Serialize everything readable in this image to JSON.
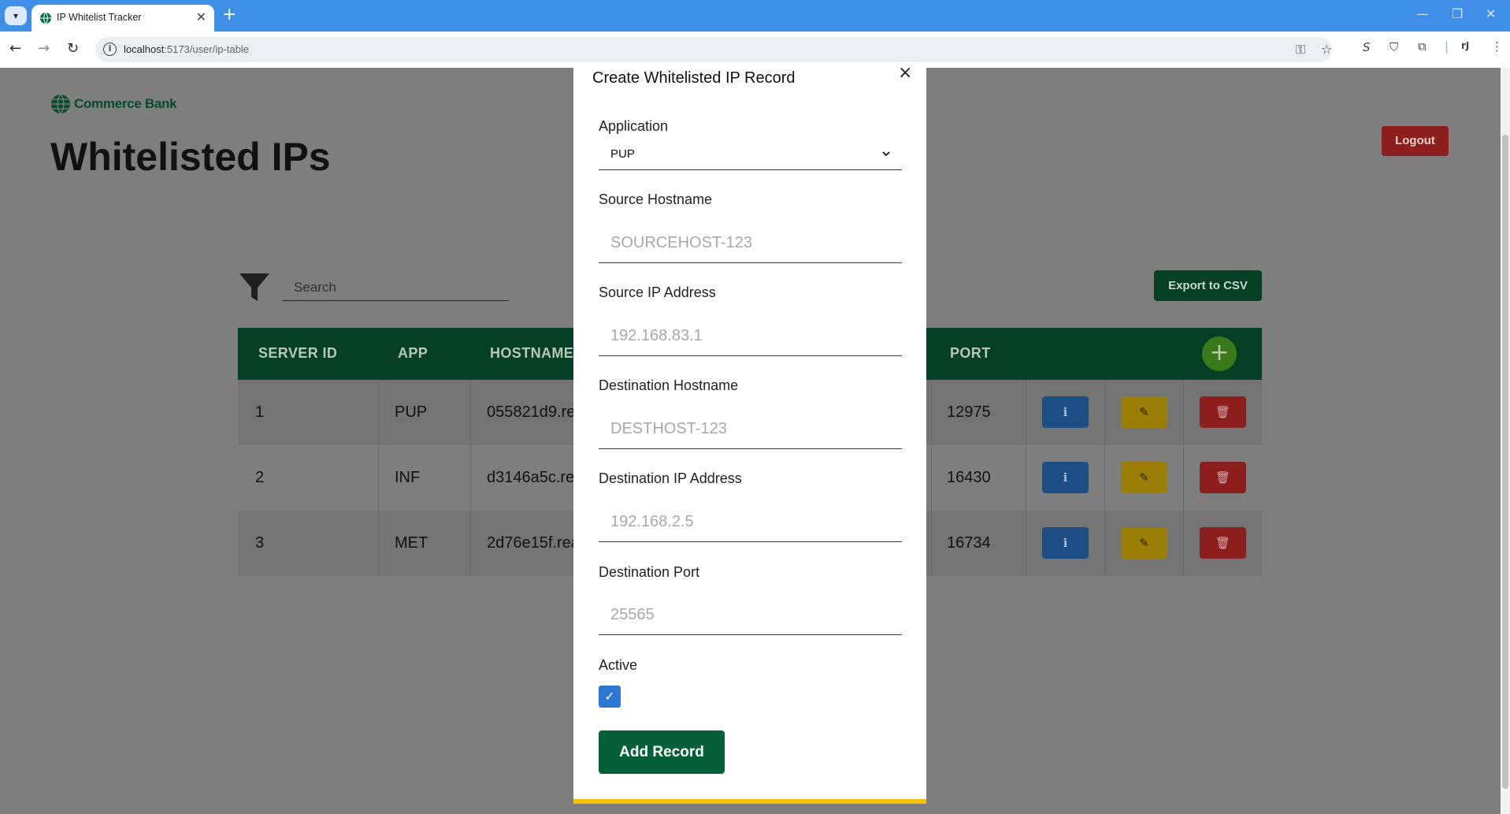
{
  "browser": {
    "tab_title": "IP Whitelist Tracker",
    "url_host": "localhost",
    "url_path": ":5173/user/ip-table"
  },
  "page": {
    "logo_text": "Commerce Bank",
    "title": "Whitelisted IPs",
    "logout_label": "Logout",
    "search_placeholder": "Search",
    "export_label": "Export to CSV"
  },
  "table": {
    "headers": [
      "SERVER ID",
      "APP",
      "HOSTNAME",
      "PORT"
    ],
    "rows": [
      {
        "id": "1",
        "app": "PUP",
        "hostname": "055821d9.re",
        "port": "12975"
      },
      {
        "id": "2",
        "app": "INF",
        "hostname": "d3146a5c.re",
        "port": "16430"
      },
      {
        "id": "3",
        "app": "MET",
        "hostname": "2d76e15f.rea",
        "port": "16734"
      }
    ]
  },
  "modal": {
    "title": "Create Whitelisted IP Record",
    "application_label": "Application",
    "application_value": "PUP",
    "source_hostname_label": "Source Hostname",
    "source_hostname_placeholder": "SOURCEHOST-123",
    "source_ip_label": "Source IP Address",
    "source_ip_placeholder": "192.168.83.1",
    "dest_hostname_label": "Destination Hostname",
    "dest_hostname_placeholder": "DESTHOST-123",
    "dest_ip_label": "Destination IP Address",
    "dest_ip_placeholder": "192.168.2.5",
    "dest_port_label": "Destination Port",
    "dest_port_placeholder": "25565",
    "active_label": "Active",
    "active_checked": true,
    "submit_label": "Add Record"
  },
  "colors": {
    "primary_green": "#05603a",
    "header_green": "#053f26",
    "modal_accent_yellow": "#f4c20d",
    "info_blue": "#2e78d4"
  }
}
